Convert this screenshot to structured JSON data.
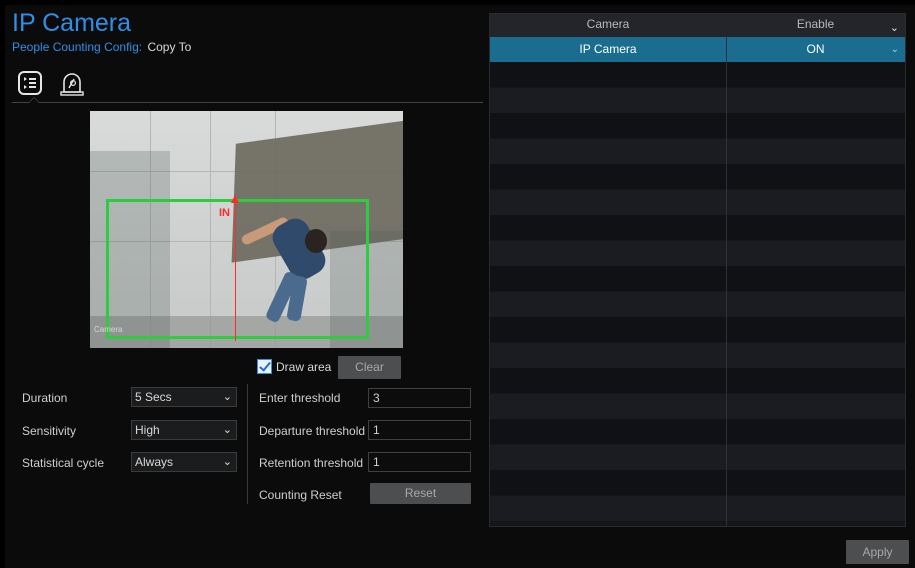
{
  "header": {
    "title": "IP Camera",
    "subtitle": "People Counting Config:",
    "copy_to": "Copy To"
  },
  "tabs": [
    {
      "name": "config-list-tab",
      "icon": "list-config-icon"
    },
    {
      "name": "alarm-tab",
      "icon": "alarm-icon"
    }
  ],
  "video": {
    "direction_label": "IN",
    "stamp": "Camera"
  },
  "draw_area": {
    "label": "Draw area",
    "checked": true,
    "clear_label": "Clear"
  },
  "settings": {
    "duration": {
      "label": "Duration",
      "value": "5 Secs"
    },
    "sensitivity": {
      "label": "Sensitivity",
      "value": "High"
    },
    "cycle": {
      "label": "Statistical cycle",
      "value": "Always"
    }
  },
  "thresholds": {
    "enter": {
      "label": "Enter threshold",
      "value": "3"
    },
    "departure": {
      "label": "Departure threshold",
      "value": "1"
    },
    "retention": {
      "label": "Retention threshold",
      "value": "1"
    },
    "reset": {
      "label": "Counting Reset",
      "button": "Reset"
    }
  },
  "table": {
    "columns": [
      "Camera",
      "Enable"
    ],
    "rows": [
      {
        "camera": "IP Camera",
        "enable": "ON"
      }
    ]
  },
  "footer": {
    "apply_label": "Apply"
  },
  "colors": {
    "accent": "#2f8fe8",
    "selected_row": "#1a6d8f",
    "draw_rect": "#2ecc40",
    "direction_line": "#ff2a2a"
  }
}
